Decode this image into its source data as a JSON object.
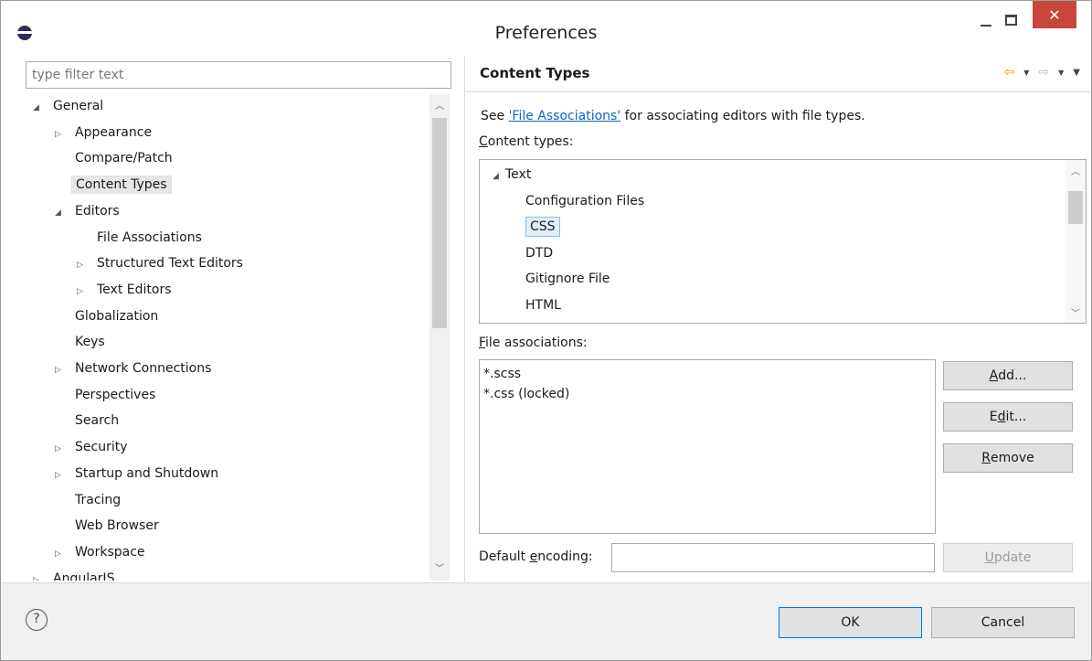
{
  "window": {
    "title": "Preferences"
  },
  "filter": {
    "placeholder": "type filter text"
  },
  "tree": [
    {
      "label": "General",
      "arrow": "◢",
      "level": 0
    },
    {
      "label": "Appearance",
      "arrow": "▷",
      "level": 1
    },
    {
      "label": "Compare/Patch",
      "arrow": "",
      "level": 1
    },
    {
      "label": "Content Types",
      "arrow": "",
      "level": 1,
      "selected": true
    },
    {
      "label": "Editors",
      "arrow": "◢",
      "level": 1
    },
    {
      "label": "File Associations",
      "arrow": "",
      "level": 2
    },
    {
      "label": "Structured Text Editors",
      "arrow": "▷",
      "level": 2
    },
    {
      "label": "Text Editors",
      "arrow": "▷",
      "level": 2
    },
    {
      "label": "Globalization",
      "arrow": "",
      "level": 1
    },
    {
      "label": "Keys",
      "arrow": "",
      "level": 1
    },
    {
      "label": "Network Connections",
      "arrow": "▷",
      "level": 1
    },
    {
      "label": "Perspectives",
      "arrow": "",
      "level": 1
    },
    {
      "label": "Search",
      "arrow": "",
      "level": 1
    },
    {
      "label": "Security",
      "arrow": "▷",
      "level": 1
    },
    {
      "label": "Startup and Shutdown",
      "arrow": "▷",
      "level": 1
    },
    {
      "label": "Tracing",
      "arrow": "",
      "level": 1
    },
    {
      "label": "Web Browser",
      "arrow": "",
      "level": 1
    },
    {
      "label": "Workspace",
      "arrow": "▷",
      "level": 1
    },
    {
      "label": "AngularJS",
      "arrow": "▷",
      "level": 0
    }
  ],
  "page": {
    "title": "Content Types",
    "desc_prefix": "See ",
    "desc_link": "'File Associations'",
    "desc_suffix": " for associating editors with file types.",
    "content_types_label_first": "C",
    "content_types_label_rest": "ontent types:",
    "content_types": [
      {
        "label": "Text",
        "arrow": "◢",
        "level": 0
      },
      {
        "label": "Configuration Files",
        "arrow": "",
        "level": 1
      },
      {
        "label": "CSS",
        "arrow": "",
        "level": 1,
        "selected": true
      },
      {
        "label": "DTD",
        "arrow": "",
        "level": 1
      },
      {
        "label": "Gitignore File",
        "arrow": "",
        "level": 1
      },
      {
        "label": "HTML",
        "arrow": "",
        "level": 1
      }
    ],
    "file_assoc_label_first": "F",
    "file_assoc_label_rest": "ile associations:",
    "file_associations": [
      "*.scss",
      "*.css (locked)"
    ],
    "buttons": {
      "add_u": "A",
      "add_rest": "dd...",
      "edit_pre": "E",
      "edit_u": "d",
      "edit_rest": "it...",
      "remove_u": "R",
      "remove_rest": "emove",
      "update_u": "U",
      "update_rest": "pdate"
    },
    "encoding_pre": "Default ",
    "encoding_u": "e",
    "encoding_rest": "ncoding:",
    "encoding_value": ""
  },
  "footer": {
    "ok": "OK",
    "cancel": "Cancel",
    "help": "?"
  },
  "colors": {
    "close": "#c9463d",
    "link": "#0b66c2",
    "selection": "#e0eef9",
    "back_arrow": "#d9a400"
  }
}
